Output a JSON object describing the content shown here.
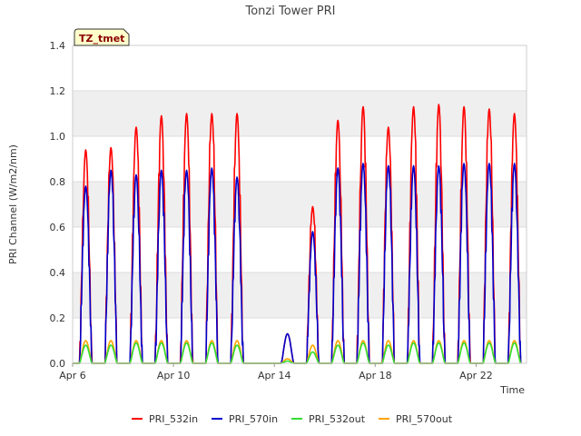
{
  "chart_data": {
    "type": "line",
    "title": "Tonzi Tower PRI",
    "xlabel": "Time",
    "ylabel": "PRI Channel (W/m2/nm)",
    "badge": "TZ_tmet",
    "ylim": [
      0,
      1.4
    ],
    "yticks": [
      "0.0",
      "0.2",
      "0.4",
      "0.6",
      "0.8",
      "1.0",
      "1.2",
      "1.4"
    ],
    "xlim": [
      "2024-04-06",
      "2024-04-24"
    ],
    "xticks": [
      {
        "date": "2024-04-06",
        "label": "Apr 6"
      },
      {
        "date": "2024-04-10",
        "label": "Apr 10"
      },
      {
        "date": "2024-04-14",
        "label": "Apr 14"
      },
      {
        "date": "2024-04-18",
        "label": "Apr 18"
      },
      {
        "date": "2024-04-22",
        "label": "Apr 22"
      }
    ],
    "grid": true,
    "legend_position": "bottom",
    "days": [
      "2024-04-06",
      "2024-04-07",
      "2024-04-08",
      "2024-04-09",
      "2024-04-10",
      "2024-04-11",
      "2024-04-12",
      "2024-04-13",
      "2024-04-14",
      "2024-04-15",
      "2024-04-16",
      "2024-04-17",
      "2024-04-18",
      "2024-04-19",
      "2024-04-20",
      "2024-04-21",
      "2024-04-22",
      "2024-04-23"
    ],
    "series": [
      {
        "name": "PRI_532in",
        "color": "#ff0000",
        "daily_peak": [
          0.94,
          0.95,
          1.04,
          1.09,
          1.1,
          1.1,
          1.1,
          0.0,
          0.13,
          0.69,
          1.07,
          1.13,
          1.04,
          1.13,
          1.14,
          1.13,
          1.12,
          1.1
        ]
      },
      {
        "name": "PRI_570in",
        "color": "#0000cc",
        "daily_peak": [
          0.78,
          0.85,
          0.83,
          0.85,
          0.85,
          0.86,
          0.82,
          0.0,
          0.13,
          0.58,
          0.86,
          0.88,
          0.87,
          0.87,
          0.87,
          0.88,
          0.88,
          0.88
        ]
      },
      {
        "name": "PRI_532out",
        "color": "#33dd33",
        "daily_peak": [
          0.08,
          0.08,
          0.09,
          0.09,
          0.09,
          0.09,
          0.08,
          0.0,
          0.01,
          0.05,
          0.08,
          0.09,
          0.08,
          0.09,
          0.09,
          0.09,
          0.09,
          0.09
        ]
      },
      {
        "name": "PRI_570out",
        "color": "#ffa500",
        "daily_peak": [
          0.1,
          0.1,
          0.1,
          0.1,
          0.1,
          0.1,
          0.1,
          0.0,
          0.02,
          0.08,
          0.1,
          0.1,
          0.1,
          0.1,
          0.1,
          0.1,
          0.1,
          0.1
        ]
      }
    ]
  }
}
